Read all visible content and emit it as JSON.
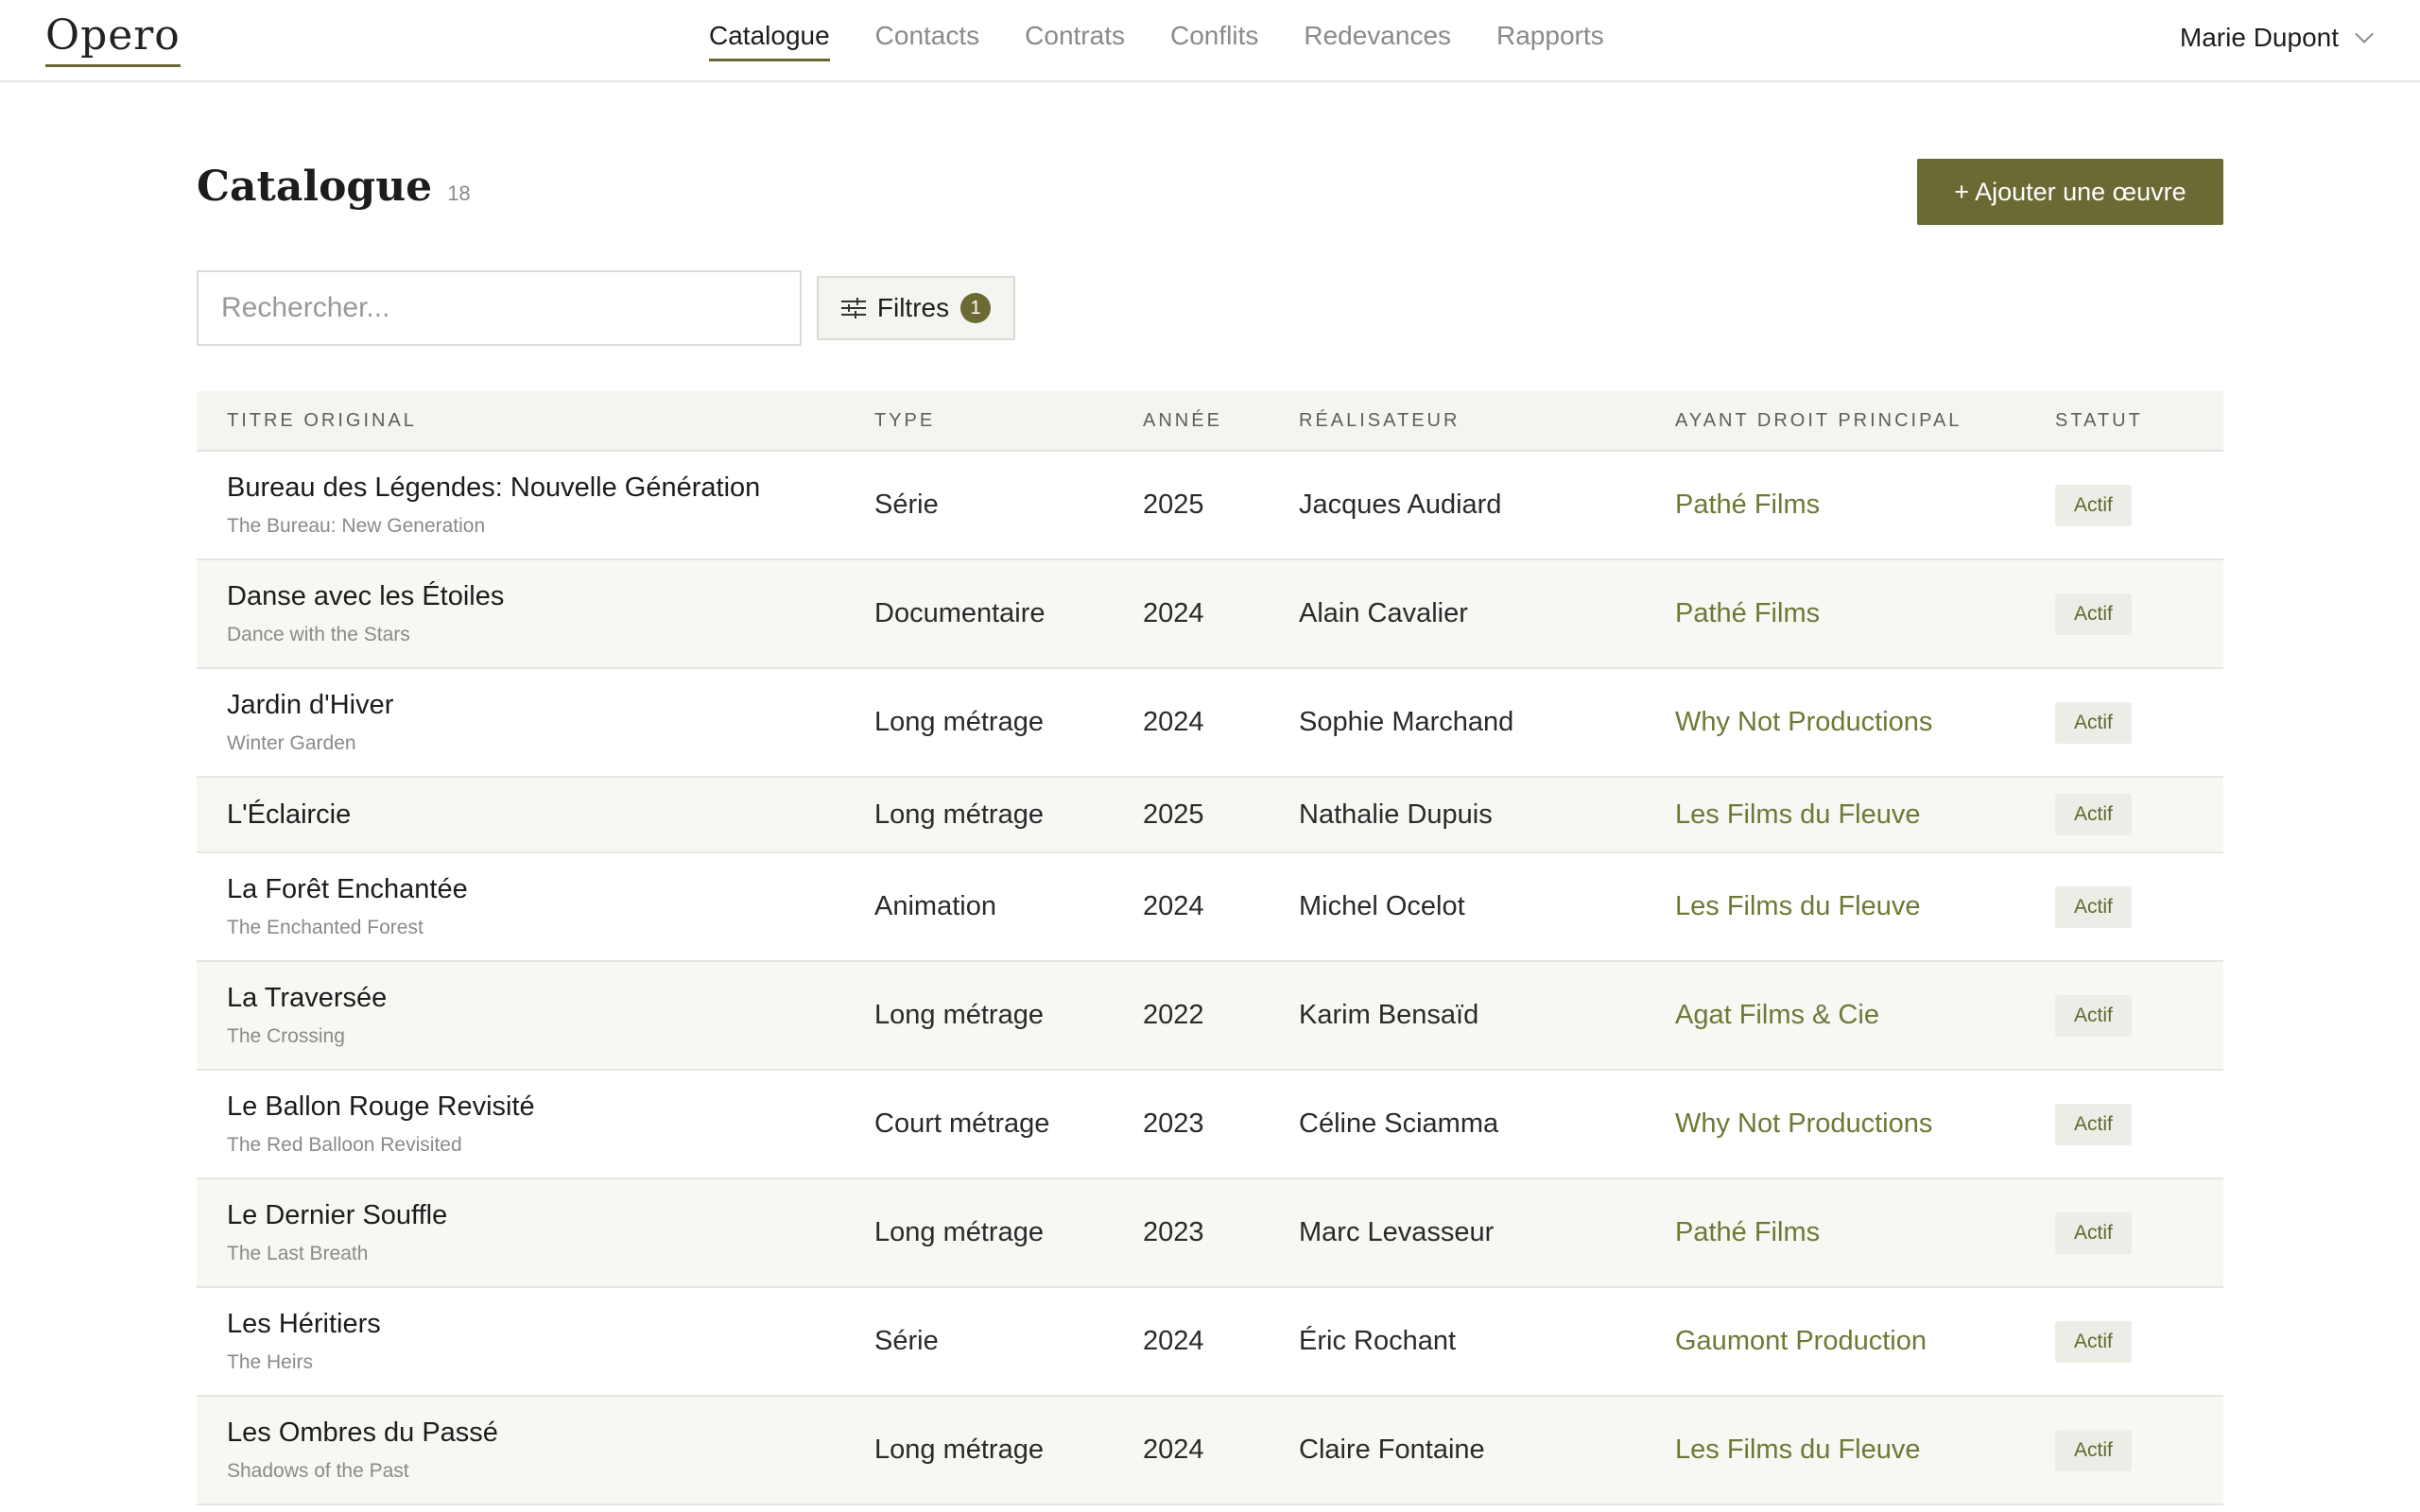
{
  "app": {
    "name": "Opero"
  },
  "nav": {
    "items": [
      {
        "label": "Catalogue",
        "active": true
      },
      {
        "label": "Contacts"
      },
      {
        "label": "Contrats"
      },
      {
        "label": "Conflits"
      },
      {
        "label": "Redevances"
      },
      {
        "label": "Rapports"
      }
    ]
  },
  "user": {
    "name": "Marie Dupont"
  },
  "page": {
    "title": "Catalogue",
    "count": "18",
    "add_button": "+ Ajouter une œuvre"
  },
  "search": {
    "placeholder": "Rechercher...",
    "value": ""
  },
  "filters": {
    "label": "Filtres",
    "count": "1"
  },
  "table": {
    "columns": [
      "Titre original",
      "Type",
      "Année",
      "Réalisateur",
      "Ayant droit principal",
      "Statut"
    ],
    "rows": [
      {
        "title": "Bureau des Légendes: Nouvelle Génération",
        "subtitle": "The Bureau: New Generation",
        "type": "Série",
        "year": "2025",
        "director": "Jacques Audiard",
        "rights_holder": "Pathé Films",
        "status": "Actif"
      },
      {
        "title": "Danse avec les Étoiles",
        "subtitle": "Dance with the Stars",
        "type": "Documentaire",
        "year": "2024",
        "director": "Alain Cavalier",
        "rights_holder": "Pathé Films",
        "status": "Actif"
      },
      {
        "title": "Jardin d'Hiver",
        "subtitle": "Winter Garden",
        "type": "Long métrage",
        "year": "2024",
        "director": "Sophie Marchand",
        "rights_holder": "Why Not Productions",
        "status": "Actif"
      },
      {
        "title": "L'Éclaircie",
        "subtitle": "",
        "type": "Long métrage",
        "year": "2025",
        "director": "Nathalie Dupuis",
        "rights_holder": "Les Films du Fleuve",
        "status": "Actif"
      },
      {
        "title": "La Forêt Enchantée",
        "subtitle": "The Enchanted Forest",
        "type": "Animation",
        "year": "2024",
        "director": "Michel Ocelot",
        "rights_holder": "Les Films du Fleuve",
        "status": "Actif"
      },
      {
        "title": "La Traversée",
        "subtitle": "The Crossing",
        "type": "Long métrage",
        "year": "2022",
        "director": "Karim Bensaïd",
        "rights_holder": "Agat Films & Cie",
        "status": "Actif"
      },
      {
        "title": "Le Ballon Rouge Revisité",
        "subtitle": "The Red Balloon Revisited",
        "type": "Court métrage",
        "year": "2023",
        "director": "Céline Sciamma",
        "rights_holder": "Why Not Productions",
        "status": "Actif"
      },
      {
        "title": "Le Dernier Souffle",
        "subtitle": "The Last Breath",
        "type": "Long métrage",
        "year": "2023",
        "director": "Marc Levasseur",
        "rights_holder": "Pathé Films",
        "status": "Actif"
      },
      {
        "title": "Les Héritiers",
        "subtitle": "The Heirs",
        "type": "Série",
        "year": "2024",
        "director": "Éric Rochant",
        "rights_holder": "Gaumont Production",
        "status": "Actif"
      },
      {
        "title": "Les Ombres du Passé",
        "subtitle": "Shadows of the Past",
        "type": "Long métrage",
        "year": "2024",
        "director": "Claire Fontaine",
        "rights_holder": "Les Films du Fleuve",
        "status": "Actif"
      }
    ]
  },
  "colors": {
    "accent": "#6b6a34",
    "link": "#6b7a35",
    "status_bg": "#ecede6"
  }
}
